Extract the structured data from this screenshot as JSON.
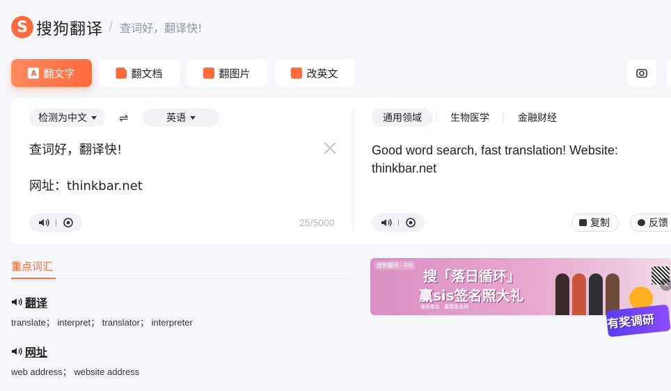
{
  "header": {
    "logo_letter": "S",
    "logo_text": "搜狗翻译",
    "slogan": "查词好，翻译快!"
  },
  "tabs": [
    {
      "label": "翻文字",
      "icon": "text-translate-icon",
      "active": true
    },
    {
      "label": "翻文档",
      "icon": "document-icon",
      "active": false
    },
    {
      "label": "翻图片",
      "icon": "image-icon",
      "active": false
    },
    {
      "label": "改英文",
      "icon": "edit-check-icon",
      "active": false
    }
  ],
  "source": {
    "lang": "检测为中文",
    "text_line1": "查词好，翻译快!",
    "text_line2": "网址：thinkbar.net",
    "counter": "25/5000"
  },
  "target": {
    "lang": "英语",
    "domains": [
      "通用领域",
      "生物医学",
      "金融财经"
    ],
    "text": "Good word search, fast translation! Website: thinkbar.net",
    "copy_label": "复制",
    "feedback_label": "反馈"
  },
  "vocab": {
    "title": "重点词汇",
    "words": [
      {
        "word": "翻译",
        "meanings": "translate；  interpret；  translator；  interpreter"
      },
      {
        "word": "网址",
        "meanings": "web address；  website address"
      }
    ]
  },
  "banner": {
    "tag": "搜狗翻译 · SIS",
    "line1": "搜「落日循环」",
    "line2": "赢sis签名照大礼",
    "footer": "搜索歌名 · 赢取签名照"
  },
  "reward": {
    "label": "有奖调研"
  },
  "colors": {
    "accent": "#ff6a3d",
    "banner_pink": "#d98fc2",
    "reward_purple": "#6b44f5"
  }
}
